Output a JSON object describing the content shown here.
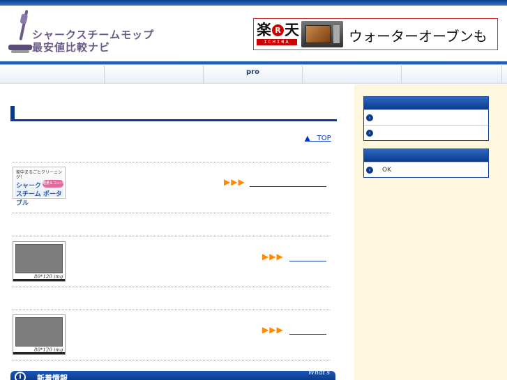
{
  "header": {
    "logo_line1": "シャークスチームモップ",
    "logo_line2": "最安値比較ナビ",
    "banner": {
      "rakuten_text": "楽天",
      "rakuten_dot": "R",
      "ichiba_text": "ICHIBA",
      "text": "ウォーターオーブンも"
    }
  },
  "nav": {
    "items": [
      "",
      "",
      "pro",
      "",
      ""
    ]
  },
  "main": {
    "top_link": "▲　TOP",
    "arrow_text": "▶▶▶",
    "portable_thumb": {
      "small_text": "家中まるごとクリーニング！",
      "line1": "シャーク",
      "line2": "スチーム ポータブル",
      "badge": "軽量＆コンパクト"
    },
    "placeholder_caption": "80*120 img",
    "news": {
      "icon": "i",
      "title": "新着情報",
      "whats": "What's"
    }
  },
  "sidebar": {
    "box1_items": [
      "",
      ""
    ],
    "box2_items": [
      "OK"
    ],
    "bullet": "›"
  },
  "colors": {
    "brand_blue": "#0b3a8c",
    "arrow_orange": "#ff8a00",
    "sidebar_bg": "#fdf7df",
    "banner_red": "#cc0000"
  }
}
